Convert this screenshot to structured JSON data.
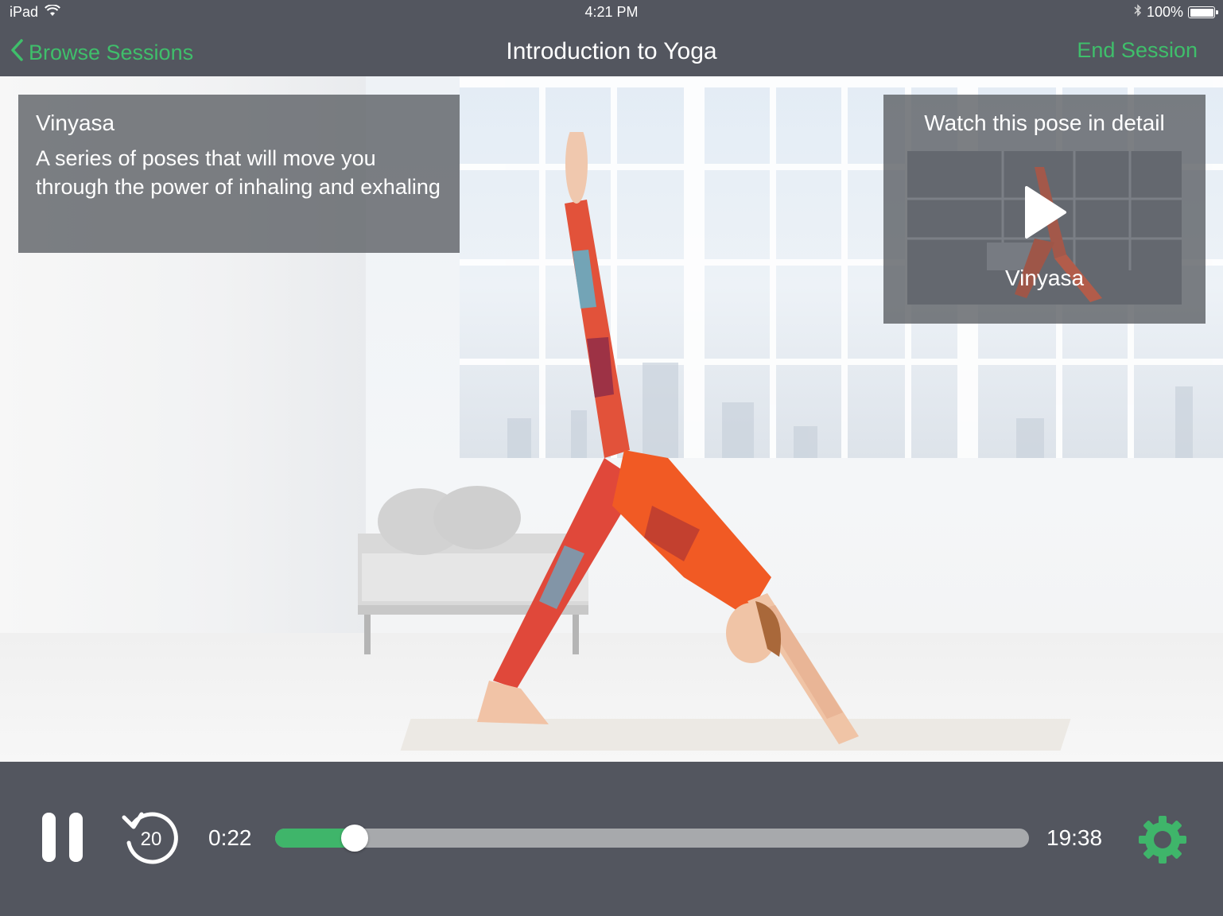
{
  "status_bar": {
    "device": "iPad",
    "time": "4:21 PM",
    "battery": "100%",
    "battery_level": 1.0
  },
  "nav": {
    "back_label": "Browse Sessions",
    "title": "Introduction to Yoga",
    "end_label": "End Session",
    "accent_color": "#3fbf6b"
  },
  "info": {
    "title": "Vinyasa",
    "description": "A series of poses that will move you through the power of inhaling and exhaling"
  },
  "detail": {
    "title": "Watch this pose in detail",
    "thumbnail_label": "Vinyasa"
  },
  "player": {
    "current_time": "0:22",
    "total_time": "19:38",
    "replay_seconds": "20",
    "progress_fraction": 0.105,
    "progress_color": "#3fb56a",
    "settings_color": "#3fb56a"
  }
}
